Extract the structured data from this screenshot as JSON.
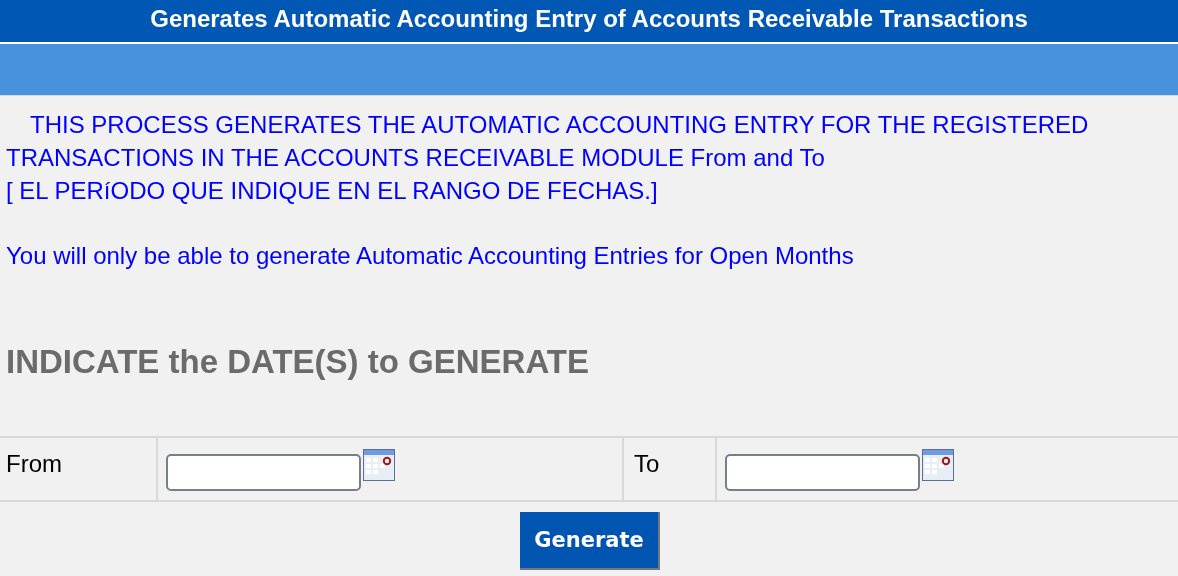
{
  "window": {
    "title": "Generates Automatic Accounting Entry of Accounts Receivable Transactions"
  },
  "intro": [
    "THIS PROCESS GENERATES THE AUTOMATIC ACCOUNTING ENTRY FOR THE REGISTERED TRANSACTIONS IN THE ACCOUNTS RECEIVABLE MODULE From and To",
    "[ EL PERíODO QUE INDIQUE EN EL RANGO DE FECHAS.]"
  ],
  "note": "You will only be able to generate Automatic Accounting Entries for Open Months",
  "heading": "INDICATE the DATE(S) to GENERATE",
  "fields": [
    {
      "label": "From"
    },
    {
      "label": "To"
    }
  ],
  "buttons": [
    "Generate"
  ]
}
